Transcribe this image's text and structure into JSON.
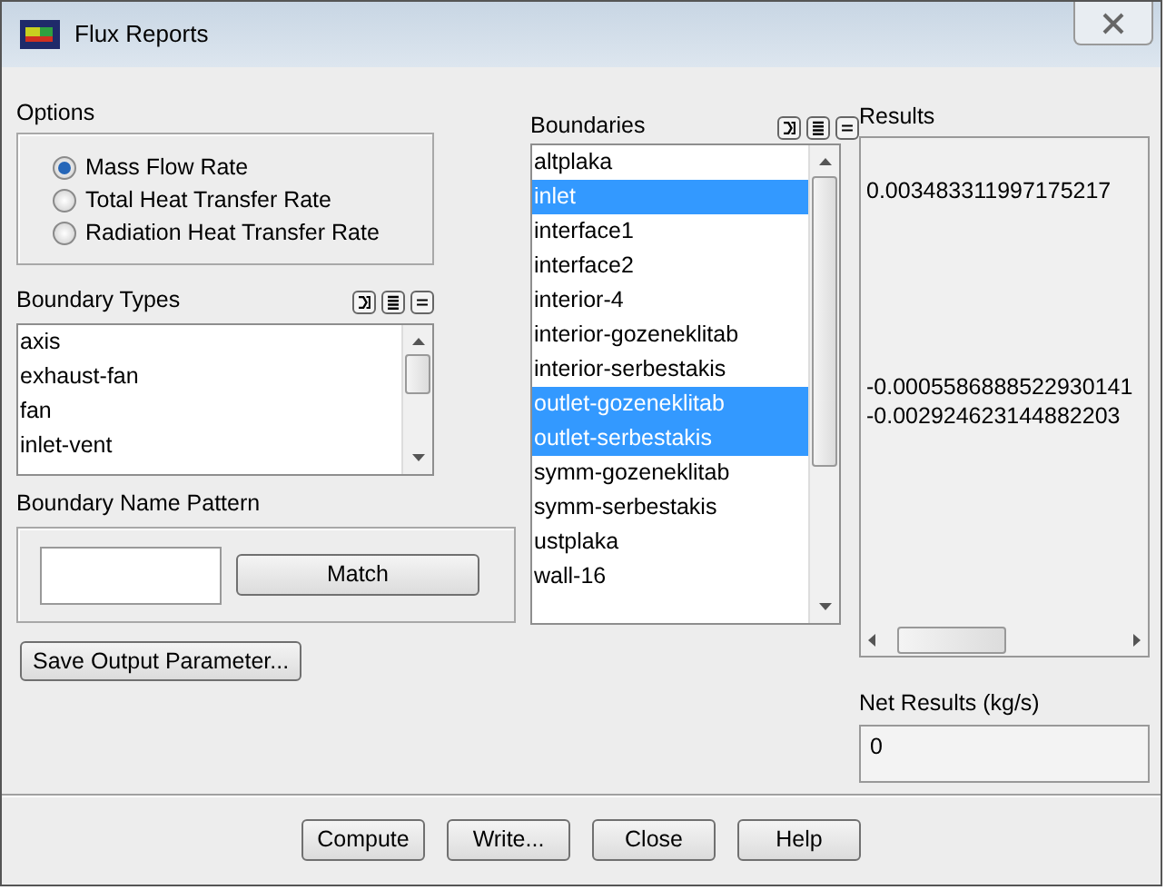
{
  "window": {
    "title": "Flux Reports"
  },
  "options": {
    "label": "Options",
    "items": [
      {
        "label": "Mass Flow Rate",
        "selected": true
      },
      {
        "label": "Total Heat Transfer Rate",
        "selected": false
      },
      {
        "label": "Radiation Heat Transfer Rate",
        "selected": false
      }
    ]
  },
  "boundary_types": {
    "label": "Boundary Types",
    "items": [
      "axis",
      "exhaust-fan",
      "fan",
      "inlet-vent"
    ]
  },
  "boundary_name_pattern": {
    "label": "Boundary Name Pattern",
    "button": "Match"
  },
  "save_button": "Save Output Parameter...",
  "boundaries": {
    "label": "Boundaries",
    "items": [
      {
        "label": "altplaka",
        "selected": false
      },
      {
        "label": "inlet",
        "selected": true
      },
      {
        "label": "interface1",
        "selected": false
      },
      {
        "label": "interface2",
        "selected": false
      },
      {
        "label": "interior-4",
        "selected": false
      },
      {
        "label": "interior-gozeneklitab",
        "selected": false
      },
      {
        "label": "interior-serbestakis",
        "selected": false
      },
      {
        "label": "outlet-gozeneklitab",
        "selected": true
      },
      {
        "label": "outlet-serbestakis",
        "selected": true
      },
      {
        "label": "symm-gozeneklitab",
        "selected": false
      },
      {
        "label": "symm-serbestakis",
        "selected": false
      },
      {
        "label": "ustplaka",
        "selected": false
      },
      {
        "label": "wall-16",
        "selected": false
      }
    ]
  },
  "results": {
    "label": "Results",
    "values": [
      "0.003483311997175217",
      "-0.0005586888522930141",
      "-0.002924623144882203"
    ]
  },
  "net_results": {
    "label": "Net Results (kg/s)",
    "value": "0"
  },
  "buttons": [
    "Compute",
    "Write...",
    "Close",
    "Help"
  ]
}
